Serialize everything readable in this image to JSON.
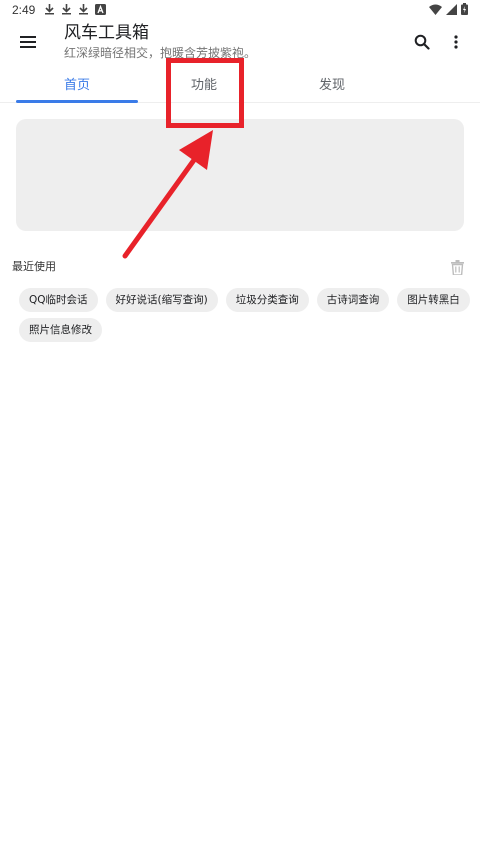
{
  "status_bar": {
    "time": "2:49",
    "left_icons": [
      "download-icon",
      "download-icon",
      "download-icon",
      "a-icon"
    ],
    "right_icons": [
      "wifi-icon",
      "signal-icon",
      "battery-icon"
    ]
  },
  "app_bar": {
    "title": "风车工具箱",
    "subtitle": "红深绿暗径相交，抱暖含芳披紫袍。",
    "menu_icon": "menu-icon",
    "search_icon": "search-icon",
    "more_icon": "more-vert-icon"
  },
  "tabs": [
    {
      "label": "首页",
      "active": true
    },
    {
      "label": "功能",
      "active": false
    },
    {
      "label": "发现",
      "active": false
    }
  ],
  "recent": {
    "title": "最近使用",
    "clear_icon": "trash-icon",
    "items": [
      {
        "label": "QQ临时会话"
      },
      {
        "label": "好好说话(缩写查询)"
      },
      {
        "label": "垃圾分类查询"
      },
      {
        "label": "古诗词查询"
      },
      {
        "label": "图片转黑白"
      },
      {
        "label": "照片信息修改"
      }
    ]
  },
  "colors": {
    "accent": "#3a7be8",
    "annotation": "#e8222a",
    "chip_bg": "#eeeeee",
    "banner_bg": "#eeeeee"
  }
}
